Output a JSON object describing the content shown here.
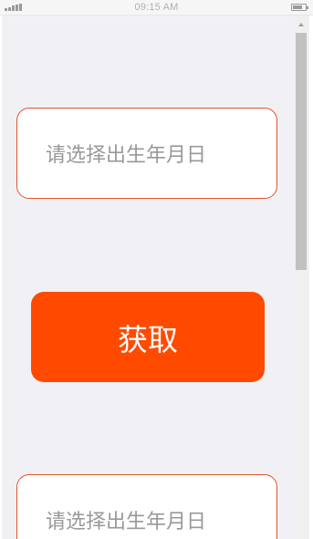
{
  "status_bar": {
    "time": "09:15 AM",
    "signal_icon": "signal-bars-icon",
    "battery_icon": "battery-icon",
    "battery_level": 0.8
  },
  "form": {
    "birthdate_field_1": {
      "placeholder": "请选择出生年月日"
    },
    "get_button": {
      "label": "获取"
    },
    "birthdate_field_2": {
      "placeholder": "请选择出生年月日"
    }
  },
  "colors": {
    "accent": "#ff4a00",
    "field_border": "#e2542c",
    "placeholder_text": "#999999",
    "background": "#f1f1f5"
  },
  "scrollbar": {
    "up_arrow_icon": "scroll-up-arrow-icon",
    "scroll_position": 0
  }
}
